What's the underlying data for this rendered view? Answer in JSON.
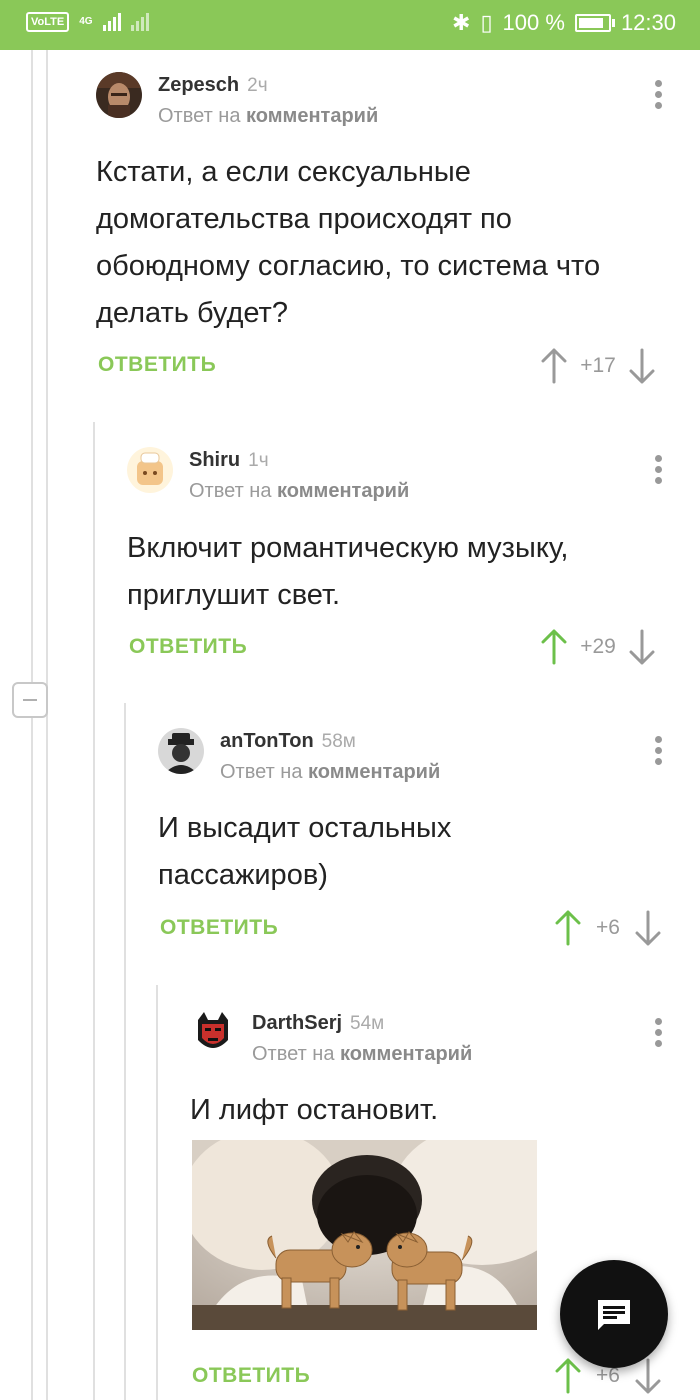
{
  "status": {
    "volte": "VoLTE",
    "network": "4G",
    "battery_text": "100 %",
    "time": "12:30",
    "battery_level": 1.0
  },
  "comments": [
    {
      "author": "Zepesch",
      "time": "2ч",
      "reply_prefix": "Ответ на",
      "reply_link": "комментарий",
      "text": [
        "Кстати, а если сексуальные",
        "домогательства происходят по",
        "обоюдному согласию, то система что",
        "делать будет?"
      ],
      "reply_label": "ОТВЕТИТЬ",
      "rating": "+17"
    },
    {
      "author": "Shiru",
      "time": "1ч",
      "reply_prefix": "Ответ на",
      "reply_link": "комментарий",
      "text": [
        "Включит романтическую музыку,",
        "приглушит свет."
      ],
      "reply_label": "ОТВЕТИТЬ",
      "rating": "+29"
    },
    {
      "author": "anTonTon",
      "time": "58м",
      "reply_prefix": "Ответ на",
      "reply_link": "комментарий",
      "text": [
        "И высадит остальных",
        "пассажиров)"
      ],
      "reply_label": "ОТВЕТИТЬ",
      "rating": "+6"
    },
    {
      "author": "DarthSerj",
      "time": "54м",
      "reply_prefix": "Ответ на",
      "reply_link": "комментарий",
      "text": [
        "И лифт остановит."
      ],
      "reply_label": "ОТВЕТИТЬ",
      "rating": "+6"
    }
  ],
  "colors": {
    "accent": "#8ac858",
    "upvoted": "#6cc04a",
    "neutral": "#999999",
    "fab": "#111111"
  },
  "icons": {
    "fab": "chat-icon",
    "up": "arrow-up-icon",
    "down": "arrow-down-icon",
    "more": "more-vertical-icon",
    "collapse": "collapse-thread-icon"
  }
}
